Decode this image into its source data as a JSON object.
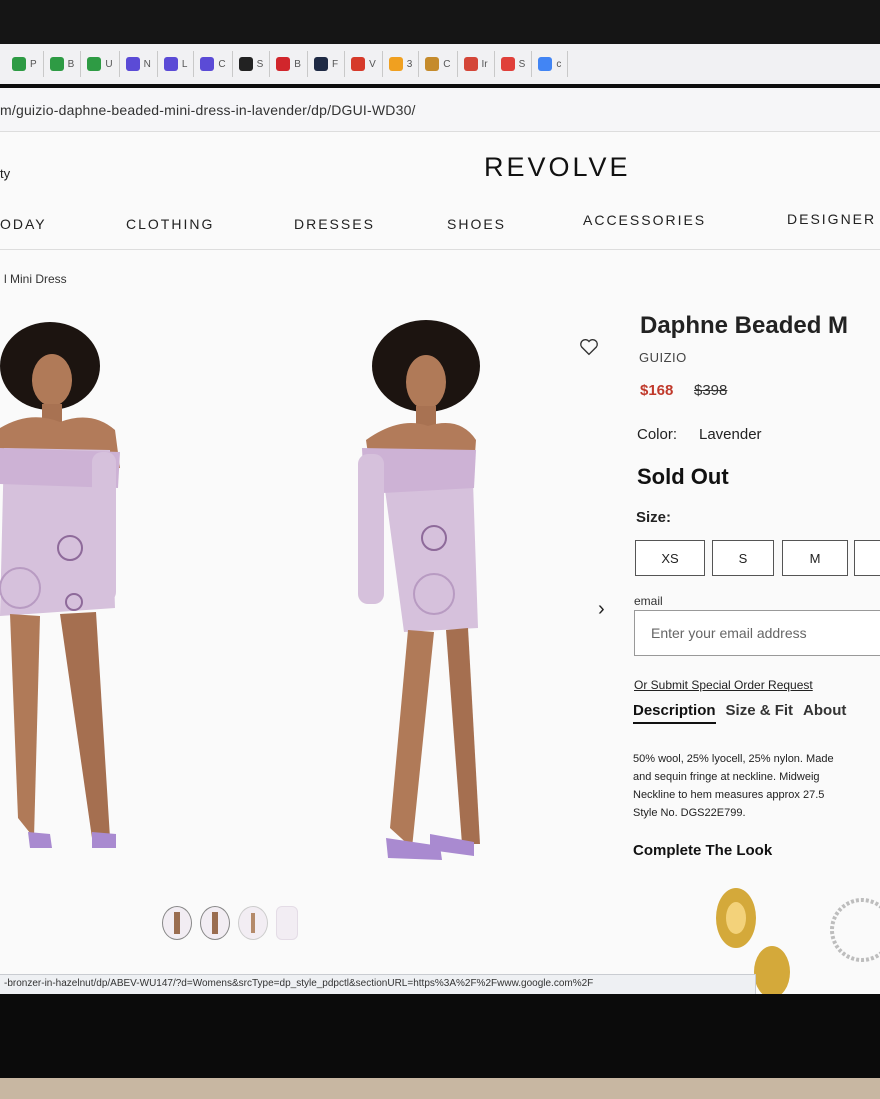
{
  "browser": {
    "tabs": [
      {
        "icon": "plus-square-icon",
        "label": "P",
        "color": "#2e9b44"
      },
      {
        "icon": "plus-square-icon",
        "label": "B",
        "color": "#2e9b44"
      },
      {
        "icon": "plus-square-icon",
        "label": "U",
        "color": "#2e9b44"
      },
      {
        "icon": "seahorse-icon",
        "label": "N",
        "color": "#5b4bd6"
      },
      {
        "icon": "seahorse-icon",
        "label": "L",
        "color": "#5b4bd6"
      },
      {
        "icon": "seahorse-icon",
        "label": "C",
        "color": "#5b4bd6"
      },
      {
        "icon": "compass-icon",
        "label": "S",
        "color": "#222222"
      },
      {
        "icon": "maple-leaf-icon",
        "label": "B",
        "color": "#d1262c"
      },
      {
        "icon": "trend-icon",
        "label": "F",
        "color": "#1f2a44"
      },
      {
        "icon": "w-square-icon",
        "label": "V",
        "color": "#d63a2a"
      },
      {
        "icon": "calendar-icon",
        "label": "3",
        "color": "#f0a020"
      },
      {
        "icon": "r-square-icon",
        "label": "C",
        "color": "#c58b2c"
      },
      {
        "icon": "gmail-icon",
        "label": "Ir",
        "color": "#d44638"
      },
      {
        "icon": "record-icon",
        "label": "S",
        "color": "#e0403a"
      },
      {
        "icon": "google-icon",
        "label": "c",
        "color": "#4285f4"
      }
    ],
    "url": "m/guizio-daphne-beaded-mini-dress-in-lavender/dp/DGUI-WD30/",
    "status_url": "-bronzer-in-hazelnut/dp/ABEV-WU147/?d=Womens&srcType=dp_style_pdpctl&sectionURL=https%3A%2F%2Fwww.google.com%2F"
  },
  "header": {
    "brand_left": "ty",
    "logo": "REVOLVE",
    "nav": [
      "ODAY",
      "CLOTHING",
      "DRESSES",
      "SHOES",
      "ACCESSORIES",
      "DESIGNER"
    ]
  },
  "breadcrumb": "l Mini Dress",
  "product": {
    "title": "Daphne Beaded M",
    "brand": "GUIZIO",
    "price_sale": "$168",
    "price_original": "$398",
    "color_label": "Color:",
    "color_value": "Lavender",
    "availability": "Sold Out",
    "size_label": "Size:",
    "sizes": [
      "XS",
      "S",
      "M",
      ""
    ],
    "email_label": "email",
    "email_placeholder": "Enter your email address",
    "special_order_link": "Or Submit Special Order Request",
    "tabs": [
      "Description",
      "Size & Fit",
      "About"
    ],
    "description_lines": [
      "50% wool, 25% lyocell, 25% nylon. Made",
      "and sequin fringe at neckline. Midweig",
      "Neckline to hem measures approx 27.5",
      "Style No. DGS22E799."
    ],
    "complete_the_look": "Complete The Look",
    "dress_color": "#d6c1dc",
    "sale_color": "#c0392b"
  }
}
